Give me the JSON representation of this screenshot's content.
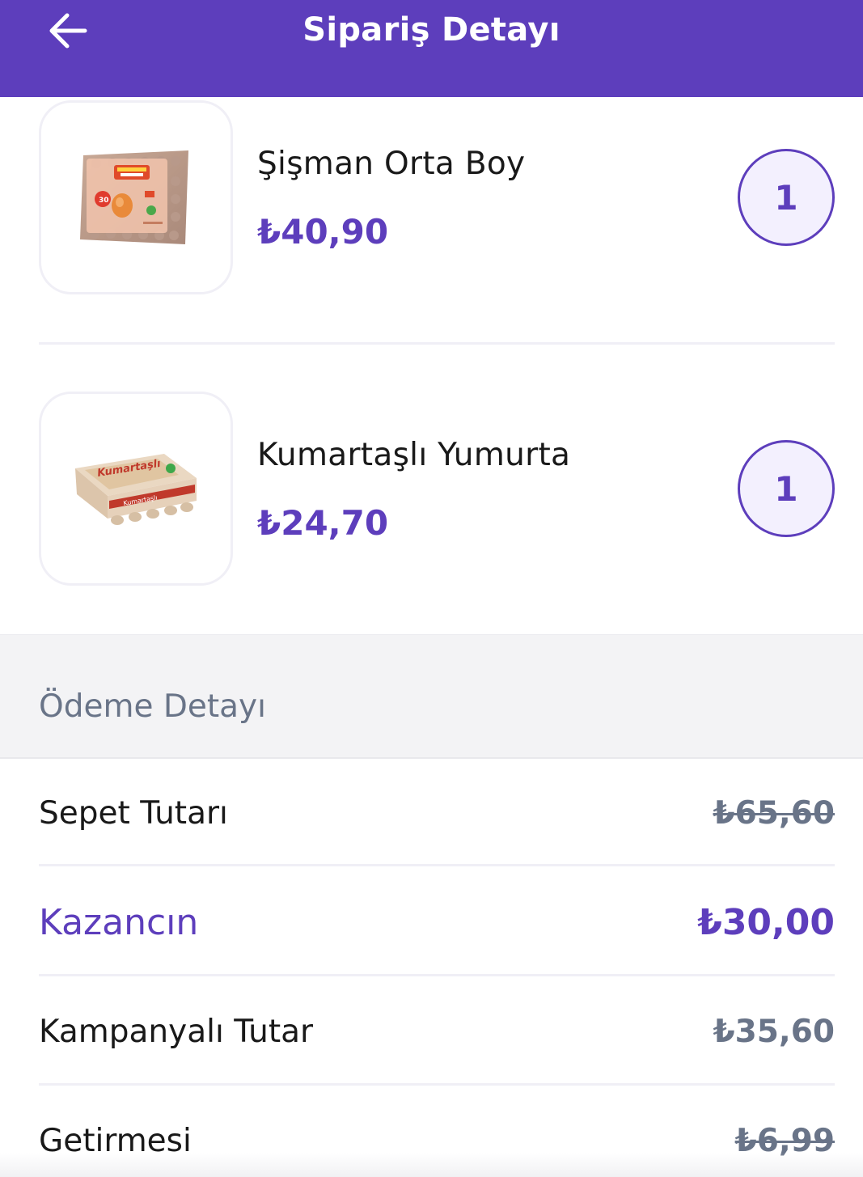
{
  "header": {
    "title": "Sipariş Detayı",
    "back_icon": "arrow-left-icon"
  },
  "items": [
    {
      "name": "Şişman Orta Boy",
      "price": "₺40,90",
      "quantity": "1",
      "image_icon": "egg-tray-30-image"
    },
    {
      "name": "Kumartaşlı Yumurta",
      "price": "₺24,70",
      "quantity": "1",
      "image_icon": "egg-carton-15-image"
    }
  ],
  "payment": {
    "title": "Ödeme Detayı",
    "rows": [
      {
        "label": "Sepet Tutarı",
        "value": "₺65,60"
      },
      {
        "label": "Kazancın",
        "value": "₺30,00"
      },
      {
        "label": "Kampanyalı Tutar",
        "value": "₺35,60"
      },
      {
        "label": "Getirmesi",
        "value": "₺6,99"
      }
    ]
  },
  "colors": {
    "brand": "#5d3ebc",
    "muted": "#697488",
    "text": "#191919"
  }
}
